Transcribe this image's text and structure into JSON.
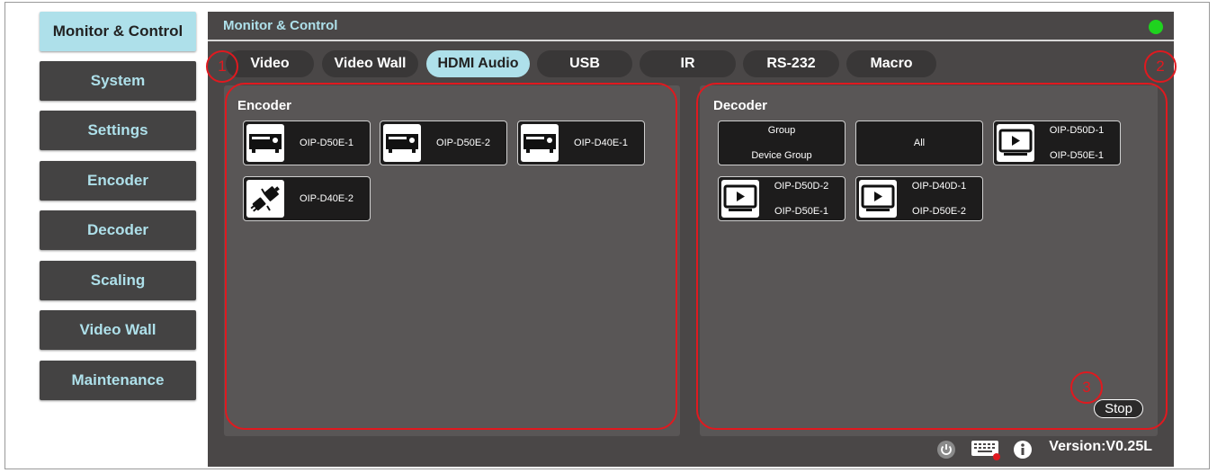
{
  "sidebar": {
    "items": [
      {
        "label": "Monitor & Control",
        "active": true
      },
      {
        "label": "System"
      },
      {
        "label": "Settings"
      },
      {
        "label": "Encoder"
      },
      {
        "label": "Decoder"
      },
      {
        "label": "Scaling"
      },
      {
        "label": "Video Wall"
      },
      {
        "label": "Maintenance"
      }
    ]
  },
  "header": {
    "title": "Monitor & Control",
    "status_color": "#1fd31f"
  },
  "tabs": [
    {
      "label": "Video"
    },
    {
      "label": "Video Wall"
    },
    {
      "label": "HDMI Audio",
      "active": true
    },
    {
      "label": "USB"
    },
    {
      "label": "IR"
    },
    {
      "label": "RS-232"
    },
    {
      "label": "Macro"
    }
  ],
  "encoder": {
    "title": "Encoder",
    "devices": [
      {
        "name": "OIP-D50E-1",
        "icon": "encoder-device-icon"
      },
      {
        "name": "OIP-D50E-2",
        "icon": "encoder-device-icon"
      },
      {
        "name": "OIP-D40E-1",
        "icon": "encoder-device-icon"
      },
      {
        "name": "OIP-D40E-2",
        "icon": "disconnected-plug-icon"
      }
    ]
  },
  "decoder": {
    "title": "Decoder",
    "group": {
      "line1": "Group",
      "line2": "Device Group"
    },
    "all_label": "All",
    "devices": [
      {
        "name": "OIP-D50D-1",
        "source": "OIP-D50E-1",
        "icon": "display-play-icon"
      },
      {
        "name": "OIP-D50D-2",
        "source": "OIP-D50E-1",
        "icon": "display-play-icon"
      },
      {
        "name": "OIP-D40D-1",
        "source": "OIP-D50E-2",
        "icon": "display-play-icon"
      }
    ]
  },
  "stop_label": "Stop",
  "annotations": [
    "1",
    "2",
    "3"
  ],
  "annotation_color": "#e0191f",
  "footer": {
    "icons": [
      "power-icon",
      "keyboard-icon",
      "info-icon"
    ],
    "version": "Version:V0.25L"
  }
}
